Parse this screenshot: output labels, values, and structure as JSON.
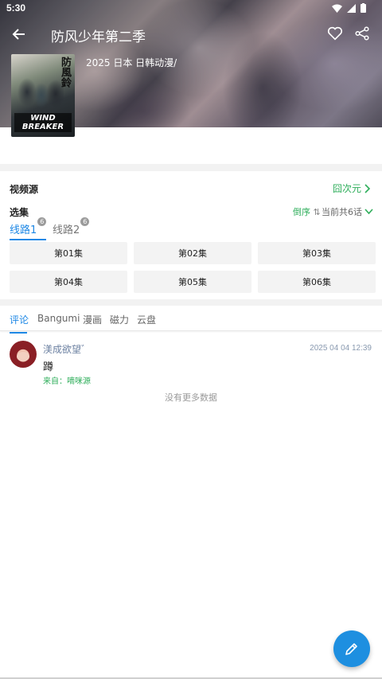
{
  "status": {
    "time": "5:30"
  },
  "appbar": {
    "title": "防风少年第二季"
  },
  "hero": {
    "info": "2025 日本 日韩动漫/",
    "poster_text": "防風鈴",
    "poster_logo": "WIND BREAKER"
  },
  "source": {
    "label": "视频源",
    "value": "囧次元"
  },
  "episodes": {
    "label": "选集",
    "order": "倒序",
    "total": "当前共6话",
    "lines": [
      {
        "label": "线路1",
        "badge": "6",
        "active": true
      },
      {
        "label": "线路2",
        "badge": "6",
        "active": false
      }
    ],
    "items": [
      "第01集",
      "第02集",
      "第03集",
      "第04集",
      "第05集",
      "第06集"
    ]
  },
  "tabs": [
    "评论",
    "Bangumi",
    "漫画",
    "磁力",
    "云盘"
  ],
  "comment": {
    "user": "渼成欲望゛",
    "time": "2025 04 04 12:39",
    "text": "蹲",
    "from": "来自：嘀咪源"
  },
  "no_more": "没有更多数据",
  "colors": {
    "accent": "#1e88e5",
    "green": "#2fae5b",
    "fab": "#1e8fe0"
  }
}
